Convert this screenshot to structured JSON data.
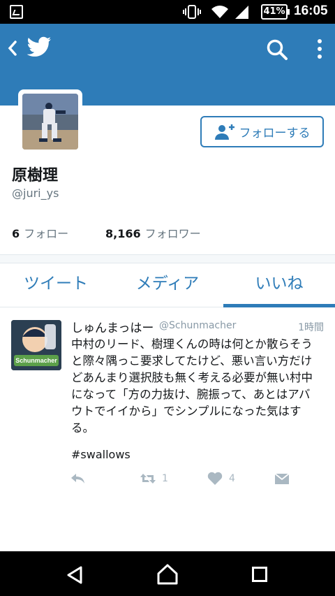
{
  "status_bar": {
    "battery": "41%",
    "time": "16:05"
  },
  "app_bar": {
    "back_icon": "chevron-left-icon",
    "logo_icon": "twitter-bird-icon",
    "search_icon": "search-icon",
    "more_icon": "more-vertical-icon",
    "banner_color": "#2e7cb8"
  },
  "profile": {
    "name": "原樹理",
    "handle": "@juri_ys",
    "follow_button_label": "フォローする",
    "following_count": "6",
    "following_label": "フォロー",
    "followers_count": "8,166",
    "followers_label": "フォロワー"
  },
  "tabs": [
    {
      "label": "ツイート",
      "active": false
    },
    {
      "label": "メディア",
      "active": false
    },
    {
      "label": "いいね",
      "active": true
    }
  ],
  "tweet": {
    "author_name": "しゅんまっはー",
    "author_handle": "@Schunmacher",
    "time": "1時間",
    "body": "中村のリード、樹理くんの時は何とか散らそうと際々隅っこ要求してたけど、悪い言い方だけどあんまり選択肢も無く考える必要が無い村中になって「方の力抜け、腕振って、あとはアバウトでイイから」でシンプルになった気はする。",
    "hashtag": "#swallows",
    "avatar_text": "Schunmacher",
    "retweet_count": "1",
    "like_count": "4"
  },
  "accent_color": "#2e7cb8"
}
